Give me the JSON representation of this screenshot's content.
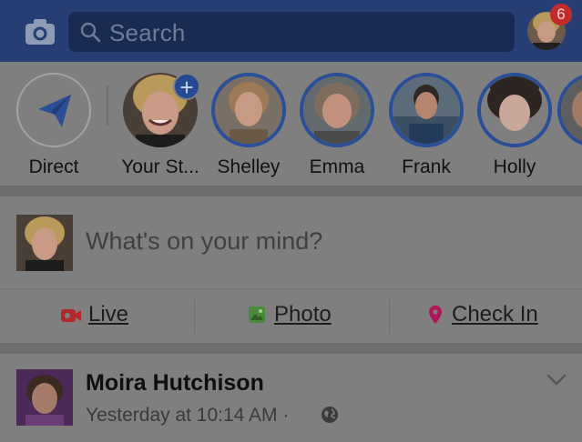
{
  "header": {
    "camera_icon": "camera-icon",
    "search_placeholder": "Search",
    "search_icon": "search-icon",
    "notification_count": "6"
  },
  "stories": {
    "items": [
      {
        "label": "Direct",
        "icon": "paper-plane-icon"
      },
      {
        "label": "Your St...",
        "add_icon": "plus-icon"
      },
      {
        "label": "Shelley"
      },
      {
        "label": "Emma"
      },
      {
        "label": "Frank"
      },
      {
        "label": "Holly"
      }
    ]
  },
  "composer": {
    "prompt": "What's on your mind?",
    "actions": [
      {
        "label": "Live",
        "icon": "live-video-icon",
        "color": "#b02a2a"
      },
      {
        "label": "Photo",
        "icon": "photo-icon",
        "color": "#4a8a3a"
      },
      {
        "label": "Check In",
        "icon": "location-pin-icon",
        "color": "#b0155c"
      }
    ]
  },
  "post": {
    "author": "Moira Hutchison",
    "meta": "Yesterday at 10:14 AM ·",
    "privacy_icon": "globe-icon",
    "menu_icon": "chevron-down-icon"
  },
  "colors": {
    "header_bg": "#263e73",
    "search_bg": "#192b53",
    "overlay_bg": "#7f7f7f",
    "story_ring": "#2a4f96"
  }
}
